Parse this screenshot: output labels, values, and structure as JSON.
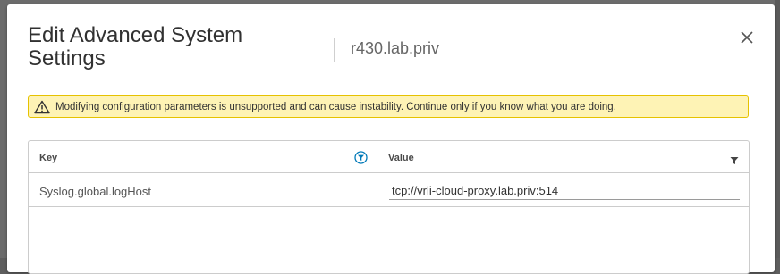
{
  "dialog": {
    "title": "Edit Advanced System Settings",
    "subtitle": "r430.lab.priv",
    "close_icon": "close-icon"
  },
  "alert": {
    "type": "warning",
    "icon": "warning-icon",
    "text": "Modifying configuration parameters is unsupported and can cause instability. Continue only if you know what you are doing."
  },
  "grid": {
    "columns": [
      {
        "label": "Key",
        "filter_icon": "filter-icon",
        "filter_active": true
      },
      {
        "label": "Value",
        "filter_icon": "filter-icon",
        "filter_active": false
      }
    ],
    "rows": [
      {
        "key": "Syslog.global.logHost",
        "value": "tcp://vrli-cloud-proxy.lab.priv:514"
      }
    ]
  },
  "colors": {
    "alert_bg": "#fef3b5",
    "alert_border": "#e6c200",
    "filter_active": "#0079b8"
  }
}
